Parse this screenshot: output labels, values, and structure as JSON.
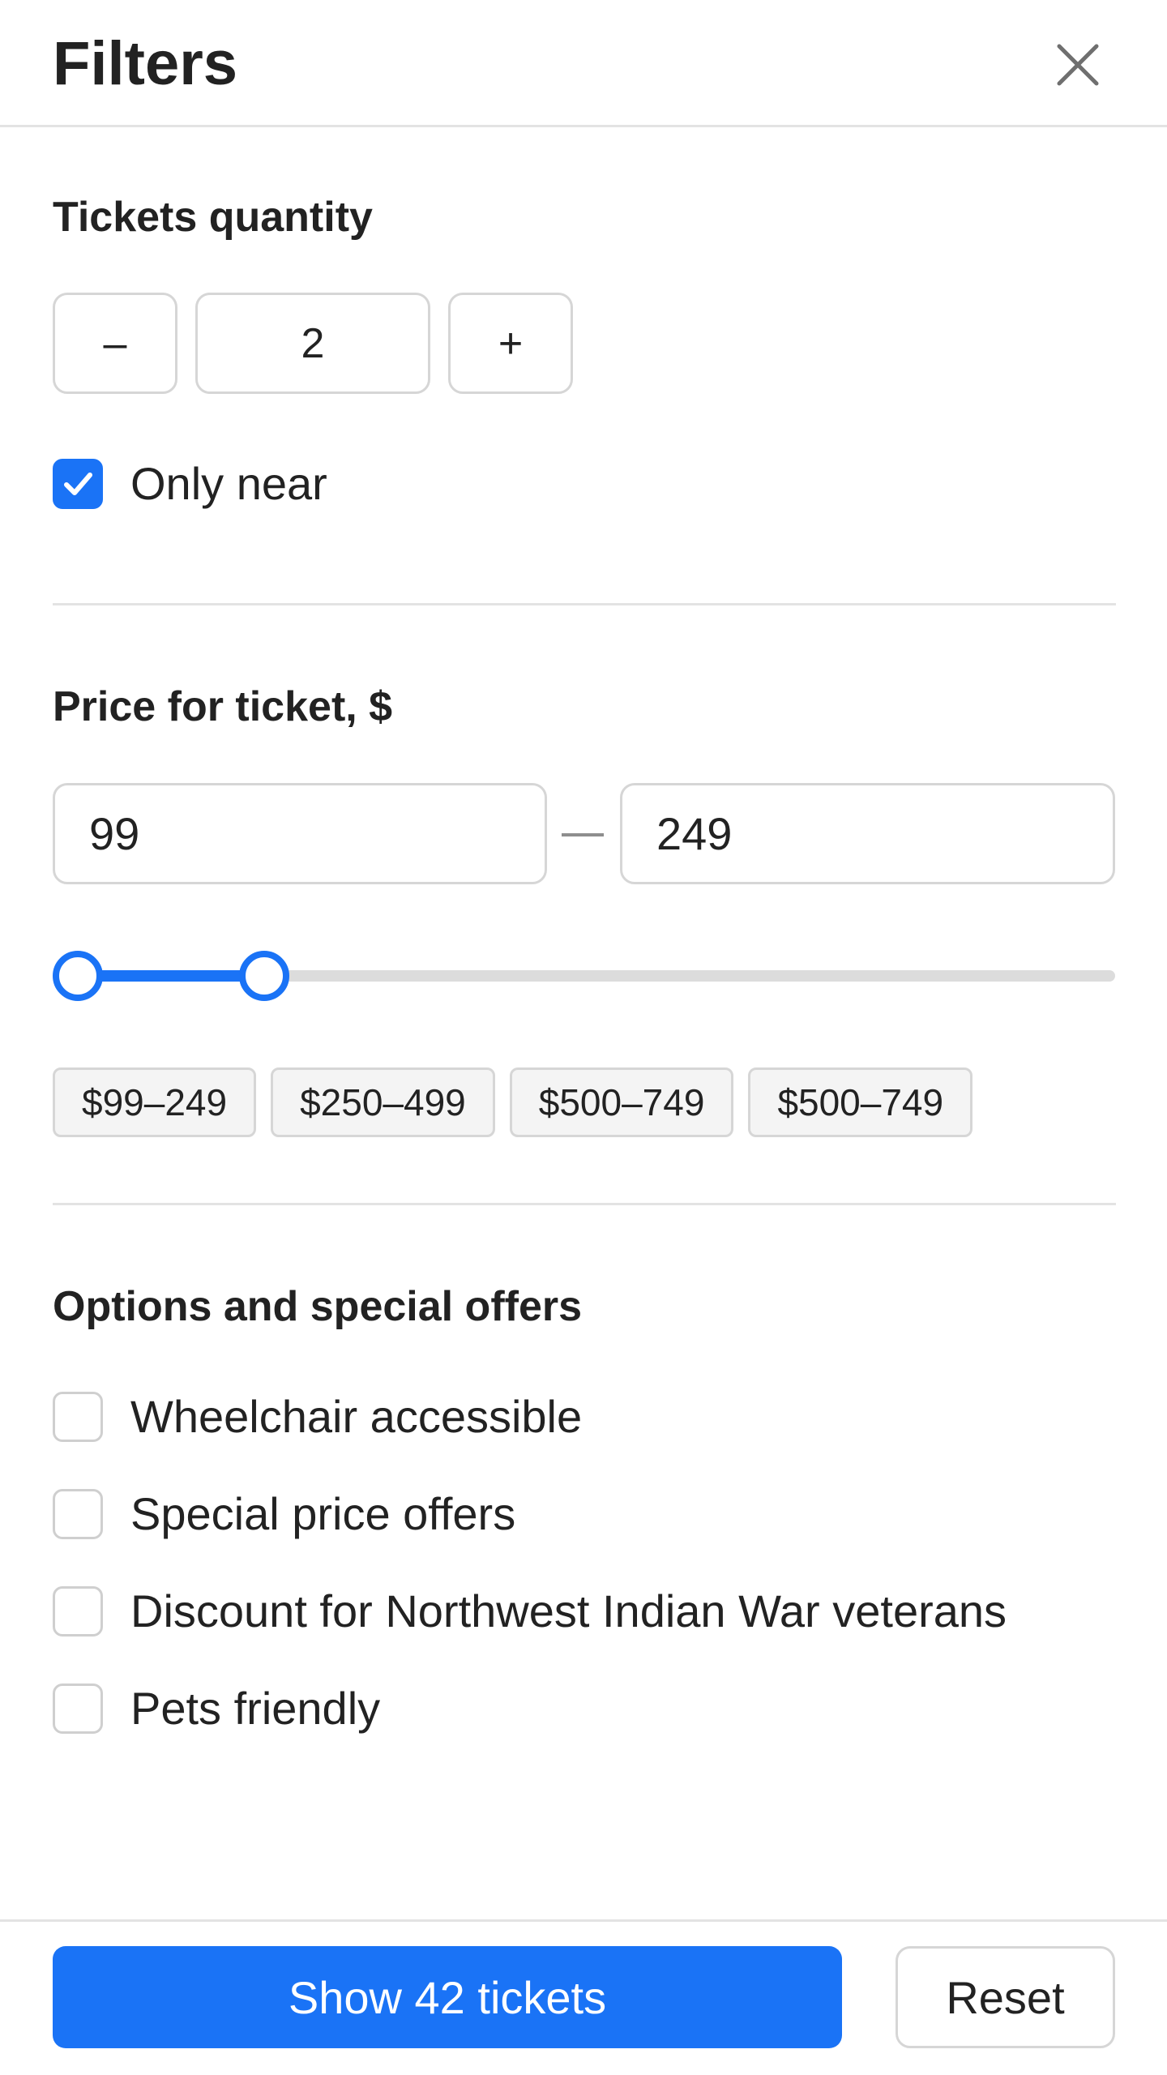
{
  "header": {
    "title": "Filters",
    "close_icon": "close-icon"
  },
  "quantity": {
    "title": "Tickets quantity",
    "decrement_label": "–",
    "value": "2",
    "increment_label": "+"
  },
  "only_near": {
    "label": "Only near",
    "checked": true
  },
  "price": {
    "title": "Price for ticket, $",
    "min_value": "99",
    "max_value": "249",
    "slider": {
      "min_fraction": 0.0,
      "max_fraction": 0.18
    },
    "chips": [
      "$99–249",
      "$250–499",
      "$500–749",
      "$500–749"
    ]
  },
  "options": {
    "title": "Options and special offers",
    "items": [
      {
        "label": "Wheelchair accessible",
        "checked": false
      },
      {
        "label": "Special price offers",
        "checked": false
      },
      {
        "label": "Discount for Northwest Indian War veterans",
        "checked": false
      },
      {
        "label": "Pets friendly",
        "checked": false
      }
    ]
  },
  "footer": {
    "show_label": "Show 42 tickets",
    "reset_label": "Reset"
  },
  "colors": {
    "accent": "#1a73f6",
    "border": "#d6d6d6",
    "divider": "#e3e3e3",
    "text": "#222222"
  }
}
